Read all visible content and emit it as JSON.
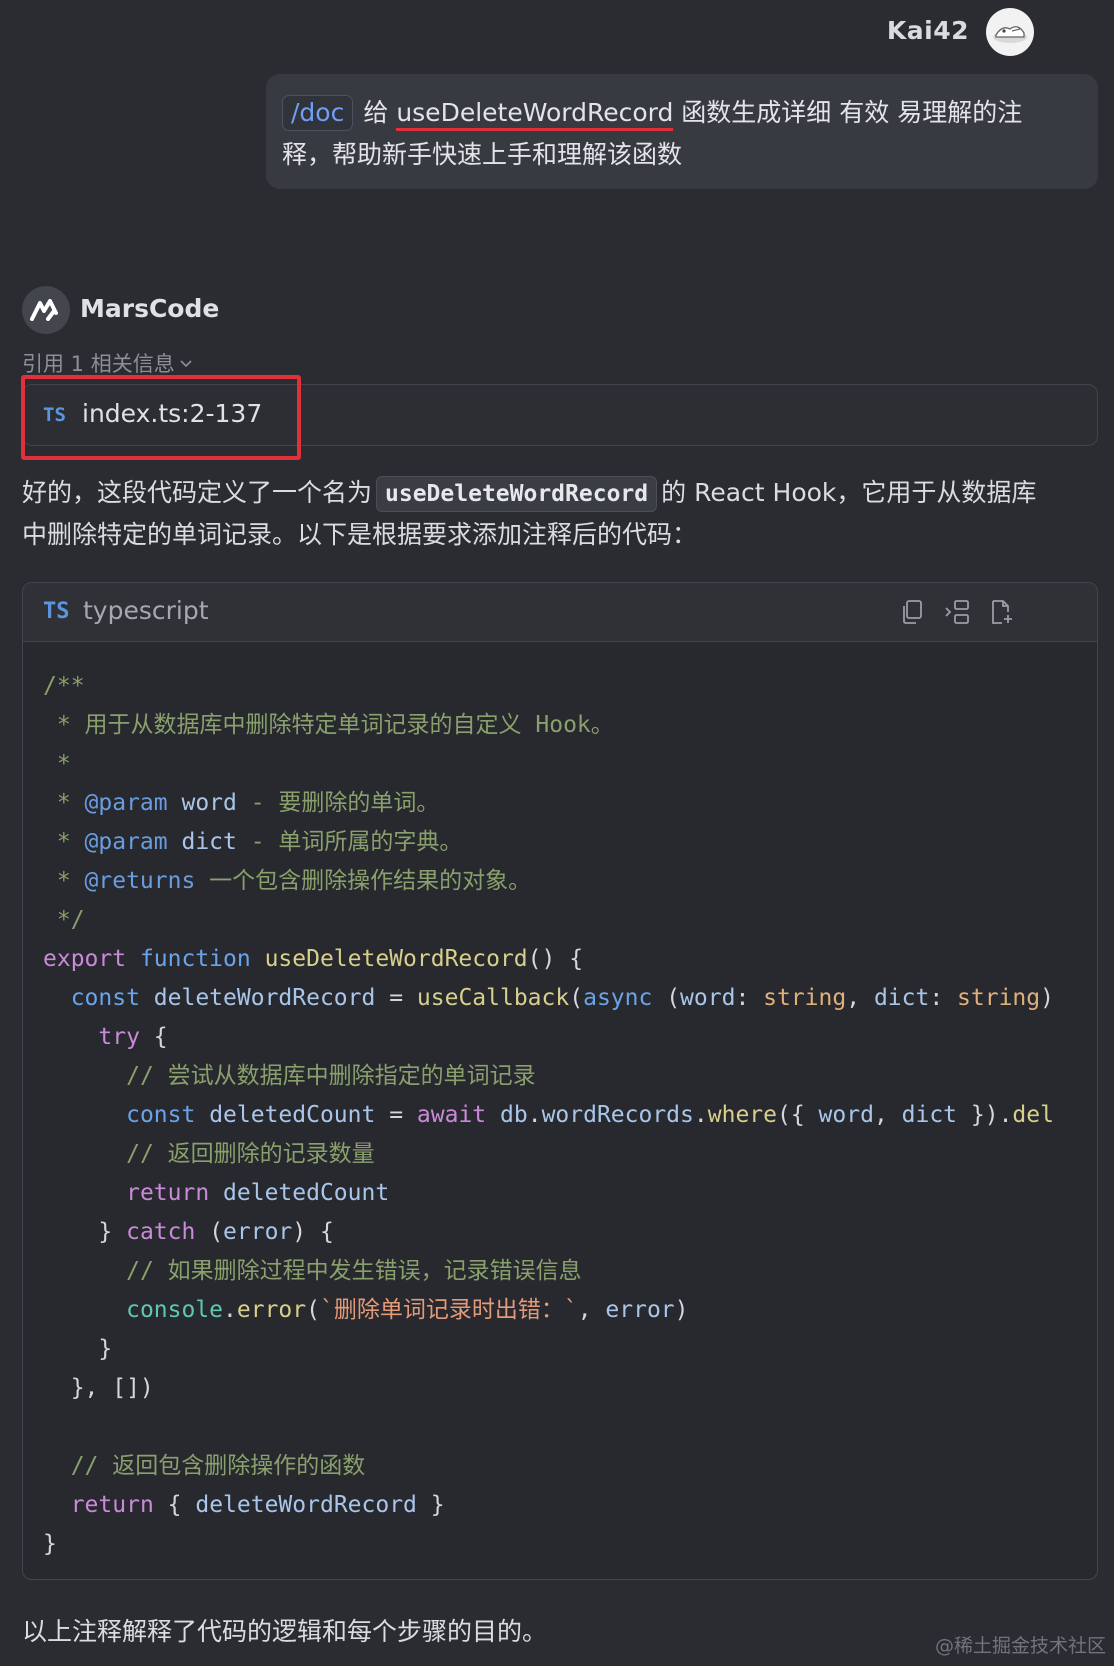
{
  "user": {
    "name": "Kai42"
  },
  "message": {
    "command": "/doc",
    "prefix": "给",
    "function_name": "useDeleteWordRecord",
    "rest_line1": "函数生成详细 有效 易理解的注",
    "line2": "释，帮助新手快速上手和理解该函数"
  },
  "assistant": {
    "name": "MarsCode",
    "reference_label": "引用 1 相关信息",
    "reference_file_lang": "TS",
    "reference_file": "index.ts:2-137"
  },
  "answer": {
    "part1": "好的，这段代码定义了一个名为",
    "code": "useDeleteWordRecord",
    "part2": "的 React Hook，它用于从数据库",
    "line2": "中删除特定的单词记录。以下是根据要求添加注释后的代码："
  },
  "code_block": {
    "lang_badge": "TS",
    "lang_name": "typescript",
    "tools": [
      "copy-icon",
      "insert-icon",
      "new-file-icon"
    ],
    "lines": [
      [
        [
          "c-com",
          "/**"
        ]
      ],
      [
        [
          "c-com",
          " * 用于从数据库中删除特定单词记录的自定义 Hook。"
        ]
      ],
      [
        [
          "c-com",
          " *"
        ]
      ],
      [
        [
          "c-com",
          " * "
        ],
        [
          "c-tag",
          "@param"
        ],
        [
          "c-var",
          " word"
        ],
        [
          "c-com",
          " - 要删除的单词。"
        ]
      ],
      [
        [
          "c-com",
          " * "
        ],
        [
          "c-tag",
          "@param"
        ],
        [
          "c-var",
          " dict"
        ],
        [
          "c-com",
          " - 单词所属的字典。"
        ]
      ],
      [
        [
          "c-com",
          " * "
        ],
        [
          "c-tag",
          "@returns"
        ],
        [
          "c-com",
          " 一个包含删除操作结果的对象。"
        ]
      ],
      [
        [
          "c-com",
          " */"
        ]
      ],
      [
        [
          "c-kw",
          "export "
        ],
        [
          "c-kwb",
          "function "
        ],
        [
          "c-fn",
          "useDeleteWordRecord"
        ],
        [
          "",
          "() {"
        ]
      ],
      [
        [
          "",
          "  "
        ],
        [
          "c-kwb",
          "const "
        ],
        [
          "c-var",
          "deleteWordRecord"
        ],
        [
          "",
          " = "
        ],
        [
          "c-fn",
          "useCallback"
        ],
        [
          "",
          "("
        ],
        [
          "c-kwb",
          "async"
        ],
        [
          "",
          " ("
        ],
        [
          "c-var",
          "word"
        ],
        [
          "",
          ": "
        ],
        [
          "c-type",
          "string"
        ],
        [
          "",
          ", "
        ],
        [
          "c-var",
          "dict"
        ],
        [
          "",
          ": "
        ],
        [
          "c-type",
          "string"
        ],
        [
          "",
          ")"
        ]
      ],
      [
        [
          "",
          "    "
        ],
        [
          "c-kw",
          "try"
        ],
        [
          "",
          " {"
        ]
      ],
      [
        [
          "",
          "      "
        ],
        [
          "c-com",
          "// 尝试从数据库中删除指定的单词记录"
        ]
      ],
      [
        [
          "",
          "      "
        ],
        [
          "c-kwb",
          "const "
        ],
        [
          "c-var",
          "deletedCount"
        ],
        [
          "",
          " = "
        ],
        [
          "c-kw",
          "await "
        ],
        [
          "c-var",
          "db"
        ],
        [
          "",
          "."
        ],
        [
          "c-var",
          "wordRecords"
        ],
        [
          "",
          "."
        ],
        [
          "c-fn",
          "where"
        ],
        [
          "",
          "({ "
        ],
        [
          "c-var",
          "word"
        ],
        [
          "",
          ", "
        ],
        [
          "c-var",
          "dict"
        ],
        [
          "",
          " })."
        ],
        [
          "c-fn",
          "del"
        ]
      ],
      [
        [
          "",
          "      "
        ],
        [
          "c-com",
          "// 返回删除的记录数量"
        ]
      ],
      [
        [
          "",
          "      "
        ],
        [
          "c-kw",
          "return "
        ],
        [
          "c-var",
          "deletedCount"
        ]
      ],
      [
        [
          "",
          "    } "
        ],
        [
          "c-kw",
          "catch"
        ],
        [
          "",
          " ("
        ],
        [
          "c-var",
          "error"
        ],
        [
          "",
          ") {"
        ]
      ],
      [
        [
          "",
          "      "
        ],
        [
          "c-com",
          "// 如果删除过程中发生错误，记录错误信息"
        ]
      ],
      [
        [
          "",
          "      "
        ],
        [
          "c-cls",
          "console"
        ],
        [
          "",
          "."
        ],
        [
          "c-fn",
          "error"
        ],
        [
          "",
          "("
        ],
        [
          "c-str",
          "`删除单词记录时出错：`"
        ],
        [
          "",
          ", "
        ],
        [
          "c-var",
          "error"
        ],
        [
          "",
          ")"
        ]
      ],
      [
        [
          "",
          "    }"
        ]
      ],
      [
        [
          "",
          "  }, [])"
        ]
      ],
      [
        [
          "",
          ""
        ]
      ],
      [
        [
          "",
          "  "
        ],
        [
          "c-com",
          "// 返回包含删除操作的函数"
        ]
      ],
      [
        [
          "",
          "  "
        ],
        [
          "c-kw",
          "return"
        ],
        [
          "",
          " { "
        ],
        [
          "c-var",
          "deleteWordRecord"
        ],
        [
          "",
          " }"
        ]
      ],
      [
        [
          "",
          "}"
        ]
      ]
    ]
  },
  "footer": {
    "text": "以上注释解释了代码的逻辑和每个步骤的目的。",
    "watermark": "@稀土掘金技术社区"
  }
}
